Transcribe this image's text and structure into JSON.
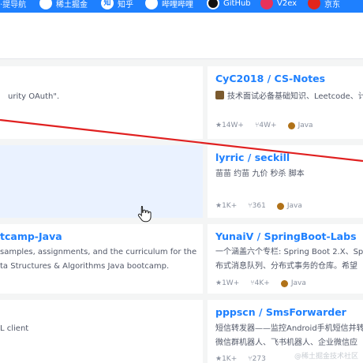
{
  "bookmarks": [
    {
      "label": "稀土掘金",
      "icon": "juejin-icon"
    },
    {
      "label": "知乎",
      "icon": "zhihu-icon"
    },
    {
      "label": "哔哩哔哩",
      "icon": "bilibili-icon"
    },
    {
      "label": "GitHub",
      "icon": "github-icon"
    },
    {
      "label": "V2ex",
      "icon": "v2ex-icon"
    },
    {
      "label": "京东",
      "icon": "jd-icon"
    }
  ],
  "left_cards": [
    {
      "title": "",
      "desc": "urity OAuth\".",
      "meta": ""
    },
    {
      "title": "",
      "desc": "",
      "meta": ""
    },
    {
      "title": "tcamp-Java",
      "desc1": "samples, assignments, and the curriculum for the",
      "desc2": "ta Structures & Algorithms Java bootcamp."
    },
    {
      "title": "",
      "desc": "L client"
    }
  ],
  "right_cards": [
    {
      "title": "CyC2018 / CS-Notes",
      "desc": "技术面试必备基础知识、Leetcode、计",
      "stars": "14W+",
      "forks": "4W+",
      "language": "Java"
    },
    {
      "title": "lyrric / seckill",
      "desc": "苗苗 约苗 九价 秒杀 脚本",
      "stars": "1K+",
      "forks": "361",
      "language": "Java"
    },
    {
      "title": "YunaiV / SpringBoot-Labs",
      "desc1": "一个涵盖六个专栏: Spring Boot 2.X、Sp",
      "desc2": "布式消息队列、分布式事务的仓库。希望",
      "stars": "1W+",
      "forks": "4K+",
      "language": "Java"
    },
    {
      "title": "pppscn / SmsForwarder",
      "desc1": "短信转发器——监控Android手机短信并转",
      "desc2": "微信群机器人、飞书机器人、企业微信应",
      "stars": "1K+",
      "forks": "273"
    }
  ],
  "watermark": "@稀土掘金技术社区",
  "colors": {
    "accent": "#1e80ff",
    "java": "#b07219",
    "annotation": "#e02020"
  }
}
